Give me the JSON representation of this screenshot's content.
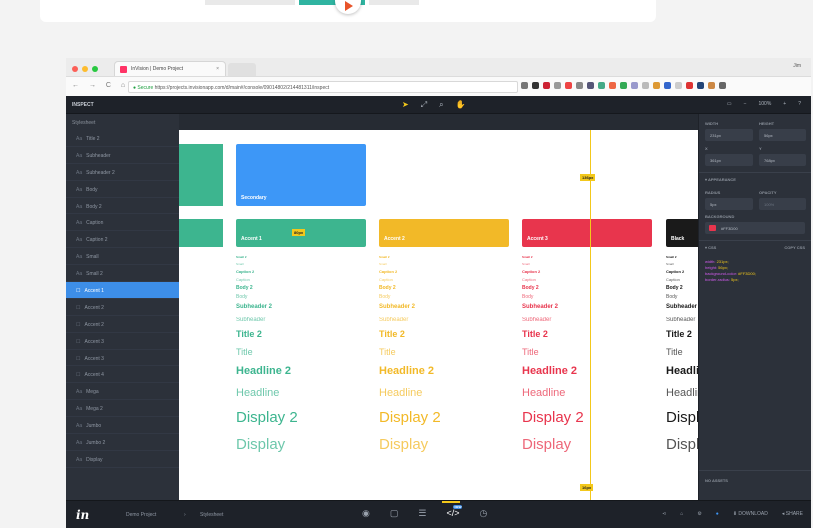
{
  "browser": {
    "tab_title": "InVision | Demo Project",
    "tab_close": "×",
    "user": "Jim",
    "nav_glyphs": "← → C ⌂",
    "secure_label": "● Secure",
    "url": "https://projects.invisionapp.com/d/main#/console/09014802/214481311/inspect"
  },
  "app": {
    "mode_label": "INSPECT",
    "toolbar_icons": [
      "pointer-icon",
      "link-icon",
      "search-icon",
      "hand-icon"
    ],
    "zoom_value": "100%",
    "zoom_minus": "−",
    "zoom_plus": "+"
  },
  "sidebar": {
    "heading": "Stylesheet",
    "items": [
      {
        "icon": "Aa",
        "label": "Title 2"
      },
      {
        "icon": "Aa",
        "label": "Subheader"
      },
      {
        "icon": "Aa",
        "label": "Subheader 2"
      },
      {
        "icon": "Aa",
        "label": "Body"
      },
      {
        "icon": "Aa",
        "label": "Body 2"
      },
      {
        "icon": "Aa",
        "label": "Caption"
      },
      {
        "icon": "Aa",
        "label": "Caption 2"
      },
      {
        "icon": "Aa",
        "label": "Small"
      },
      {
        "icon": "Aa",
        "label": "Small 2"
      },
      {
        "icon": "☐",
        "label": "Accent 1",
        "active": true
      },
      {
        "icon": "☐",
        "label": "Accent 2"
      },
      {
        "icon": "☐",
        "label": "Accent 2"
      },
      {
        "icon": "☐",
        "label": "Accent 3"
      },
      {
        "icon": "☐",
        "label": "Accent 3"
      },
      {
        "icon": "☐",
        "label": "Accent 4"
      },
      {
        "icon": "Aa",
        "label": "Mega"
      },
      {
        "icon": "Aa",
        "label": "Mega 2"
      },
      {
        "icon": "Aa",
        "label": "Jumbo"
      },
      {
        "icon": "Aa",
        "label": "Jumbo 2"
      },
      {
        "icon": "Aa",
        "label": "Display"
      }
    ]
  },
  "canvas": {
    "secondary_label": "Secondary",
    "accent_labels": [
      "Accent 1",
      "Accent 2",
      "Accent 3",
      "Black"
    ],
    "measure_labels": [
      "80px",
      "136px",
      "16px"
    ],
    "columns": [
      {
        "color": "#3db58f",
        "styles": [
          "Small 2",
          "Small",
          "Caption 2",
          "Caption",
          "Body 2",
          "Body",
          "Subheader 2",
          "Subheader",
          "Title 2",
          "Title",
          "Headline 2",
          "Headline",
          "Display 2",
          "Display"
        ]
      },
      {
        "color": "#f2b928",
        "styles": [
          "Small 2",
          "Small",
          "Caption 2",
          "Caption",
          "Body 2",
          "Body",
          "Subheader 2",
          "Subheader",
          "Title 2",
          "Title",
          "Headline 2",
          "Headline",
          "Display 2",
          "Display"
        ]
      },
      {
        "color": "#e8354d",
        "styles": [
          "Small 2",
          "Small",
          "Caption 2",
          "Caption",
          "Body 2",
          "Body",
          "Subheader 2",
          "Subheader",
          "Title 2",
          "Title",
          "Headline 2",
          "Headline",
          "Display 2",
          "Display"
        ]
      },
      {
        "color": "#1a1a1a",
        "styles": [
          "Small 2",
          "Small",
          "Caption 2",
          "Caption",
          "Body 2",
          "Body",
          "Subheader",
          "Subheader",
          "Title 2",
          "Title",
          "Headline",
          "Headline",
          "Display",
          "Display"
        ]
      }
    ]
  },
  "inspector": {
    "width_label": "WIDTH",
    "height_label": "HEIGHT",
    "width_value": "231px",
    "height_value": "56px",
    "x_label": "X",
    "y_label": "Y",
    "x_value": "361px",
    "y_value": "768px",
    "appearance_label": "▾ APPEARANCE",
    "radius_label": "RADIUS",
    "opacity_label": "OPACITY",
    "radius_value": "5px",
    "opacity_value": "100%",
    "background_label": "BACKGROUND",
    "background_value": "#FF3D00",
    "css_label": "▾ CSS",
    "copy_css_label": "COPY CSS",
    "css_lines": [
      {
        "k": "width:",
        "v": "231px;"
      },
      {
        "k": "height:",
        "v": "56px;"
      },
      {
        "k": "background-color:",
        "v": "#FF3D00;"
      },
      {
        "k": "border-radius:",
        "v": "5px;"
      }
    ],
    "no_assets_label": "NO ASSETS"
  },
  "footer": {
    "logo": "in",
    "project": "Demo Project",
    "sep": "›",
    "screen": "Stylesheet",
    "tool_icons": [
      "eye-icon",
      "comment-icon",
      "history-icon",
      "inspect-icon",
      "clock-icon"
    ],
    "tool_glyphs": [
      "◉",
      "▢",
      "☰",
      "</>",
      "◷"
    ],
    "new_badge": "NEW",
    "right_glyphs": [
      "⋖",
      "⌂",
      "⚙",
      "●"
    ],
    "download_label": "⬇ DOWNLOAD",
    "share_label": "◂ SHARE"
  },
  "colors": {
    "accent_green": "#3db58f",
    "secondary_blue": "#3d97f7",
    "accent_yellow": "#f2b928",
    "accent_red": "#e8354d",
    "active_blue": "#3d8ee8",
    "measure_yellow": "#f3c81b"
  }
}
